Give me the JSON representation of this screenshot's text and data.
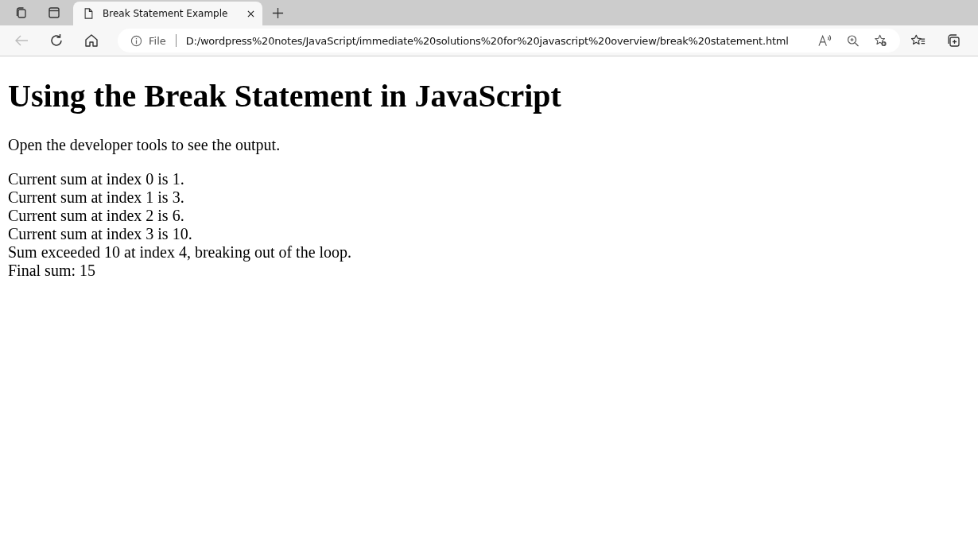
{
  "tabs": [
    {
      "title": "Break Statement Example",
      "selected": true
    }
  ],
  "address_bar": {
    "scheme_label": "File",
    "url": "D:/wordpress%20notes/JavaScript/immediate%20solutions%20for%20javascript%20overview/break%20statement.html"
  },
  "page": {
    "heading": "Using the Break Statement in JavaScript",
    "intro": "Open the developer tools to see the output.",
    "output_lines": [
      "Current sum at index 0 is 1.",
      "Current sum at index 1 is 3.",
      "Current sum at index 2 is 6.",
      "Current sum at index 3 is 10.",
      "Sum exceeded 10 at index 4, breaking out of the loop.",
      "Final sum: 15"
    ]
  }
}
